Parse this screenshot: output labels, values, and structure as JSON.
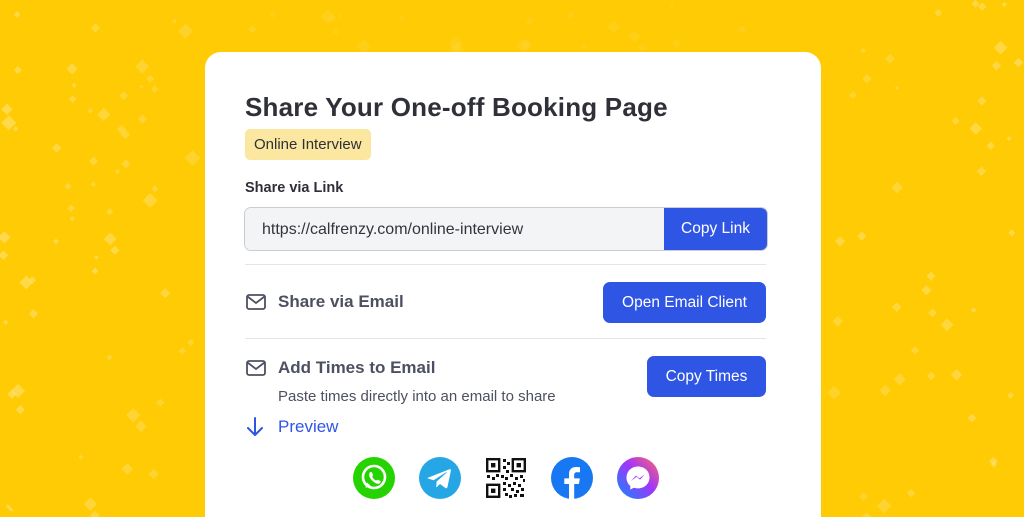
{
  "card": {
    "title": "Share Your One-off Booking Page",
    "tag": "Online Interview"
  },
  "link": {
    "label": "Share via Link",
    "url": "https://calfrenzy.com/online-interview",
    "copy_button": "Copy Link"
  },
  "email": {
    "title": "Share via Email",
    "button": "Open Email Client",
    "icon": "mail-icon"
  },
  "times": {
    "title": "Add Times to Email",
    "subtitle": "Paste times directly into an email to share",
    "button": "Copy Times",
    "icon": "mail-icon"
  },
  "preview": {
    "label": "Preview",
    "icon": "arrow-down-icon"
  },
  "share_targets": [
    {
      "name": "WhatsApp",
      "icon": "whatsapp-icon",
      "color": "#25D300"
    },
    {
      "name": "Telegram",
      "icon": "telegram-icon",
      "color": "#27A6E5"
    },
    {
      "name": "QR Code",
      "icon": "qr-code-icon",
      "color": "#111111"
    },
    {
      "name": "Facebook",
      "icon": "facebook-icon",
      "color": "#1877F2"
    },
    {
      "name": "Messenger",
      "icon": "messenger-icon",
      "color": "#A334FA"
    }
  ],
  "colors": {
    "background": "#FFCB05",
    "primary": "#2F55E4",
    "tag_bg": "#FBE7A0"
  }
}
